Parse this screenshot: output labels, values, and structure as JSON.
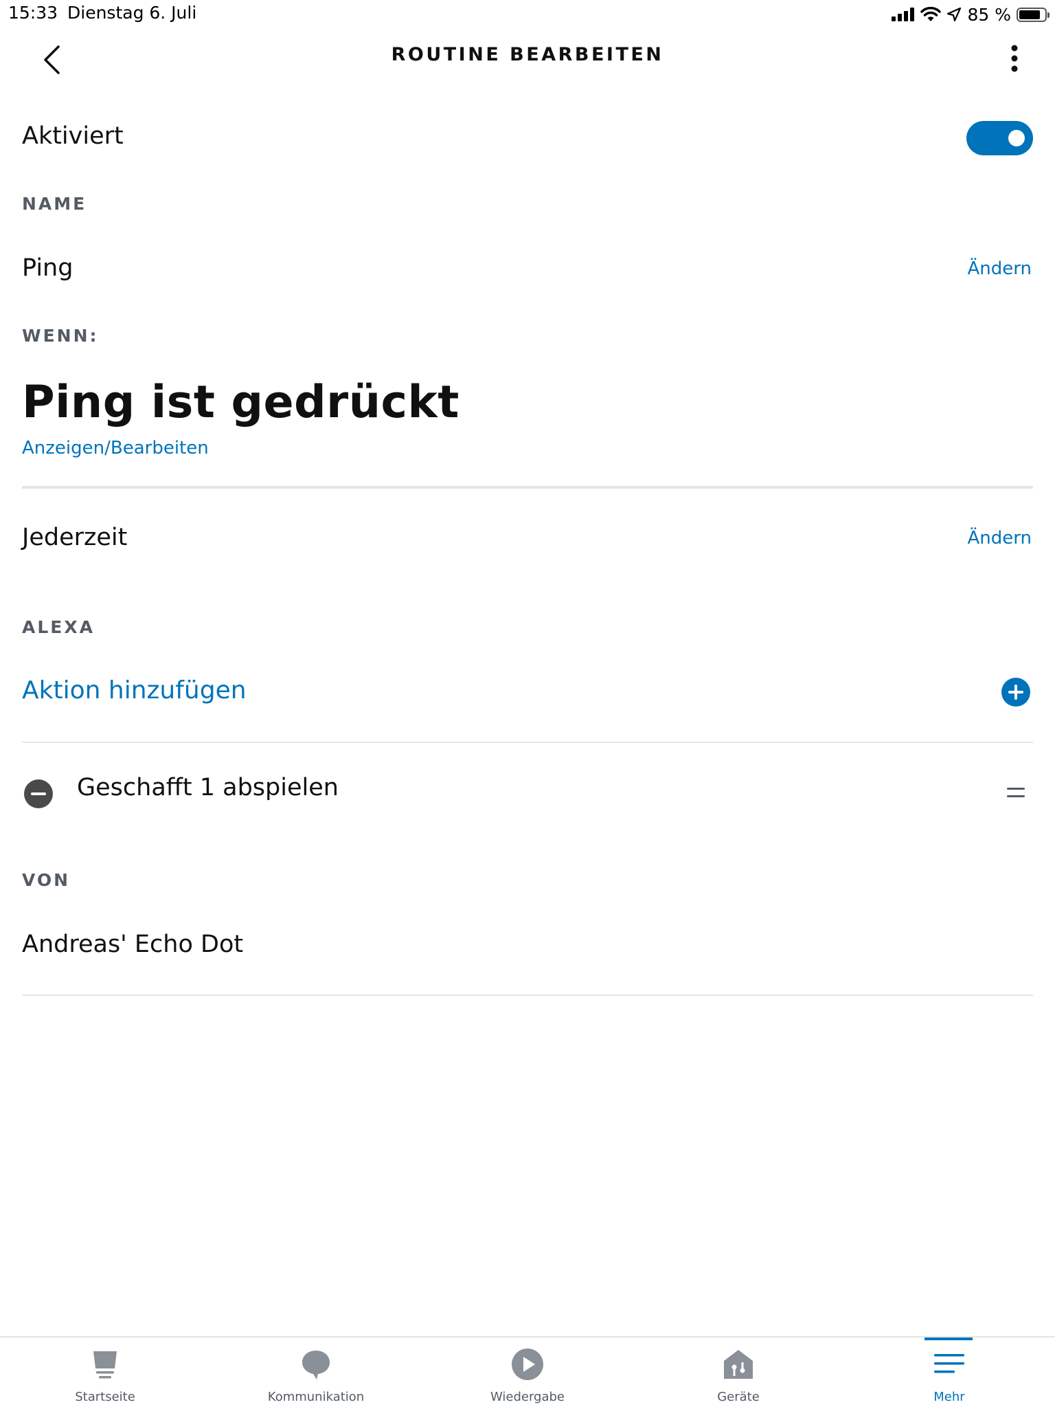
{
  "status_bar": {
    "time": "15:33",
    "date": "Dienstag 6. Juli",
    "battery_text": "85 %",
    "battery_level": 0.85
  },
  "header": {
    "title": "ROUTINE BEARBEITEN",
    "back_icon": "chevron-left-icon",
    "more_icon": "more-vertical-icon"
  },
  "enabled": {
    "label": "Aktiviert",
    "value": true
  },
  "name_section": {
    "label": "NAME",
    "value": "Ping",
    "change_label": "Ändern"
  },
  "when_section": {
    "label": "WENN:",
    "trigger": "Ping ist gedrückt",
    "view_edit_label": "Anzeigen/Bearbeiten"
  },
  "schedule": {
    "value": "Jederzeit",
    "change_label": "Ändern"
  },
  "alexa_section": {
    "label": "ALEXA",
    "add_action_label": "Aktion hinzufügen",
    "actions": [
      {
        "label": "Geschafft 1 abspielen"
      }
    ]
  },
  "from_section": {
    "label": "VON",
    "device": "Andreas' Echo Dot"
  },
  "tabbar": {
    "items": [
      {
        "label": "Startseite",
        "icon": "home-echo-icon"
      },
      {
        "label": "Kommunikation",
        "icon": "chat-bubble-icon"
      },
      {
        "label": "Wiedergabe",
        "icon": "play-circle-icon"
      },
      {
        "label": "Geräte",
        "icon": "devices-house-icon"
      },
      {
        "label": "Mehr",
        "icon": "menu-lines-icon"
      }
    ],
    "active_index": 4
  },
  "colors": {
    "accent": "#0073bb",
    "text": "#0f1111",
    "muted": "#545b64",
    "divider": "#e3e6e6"
  }
}
